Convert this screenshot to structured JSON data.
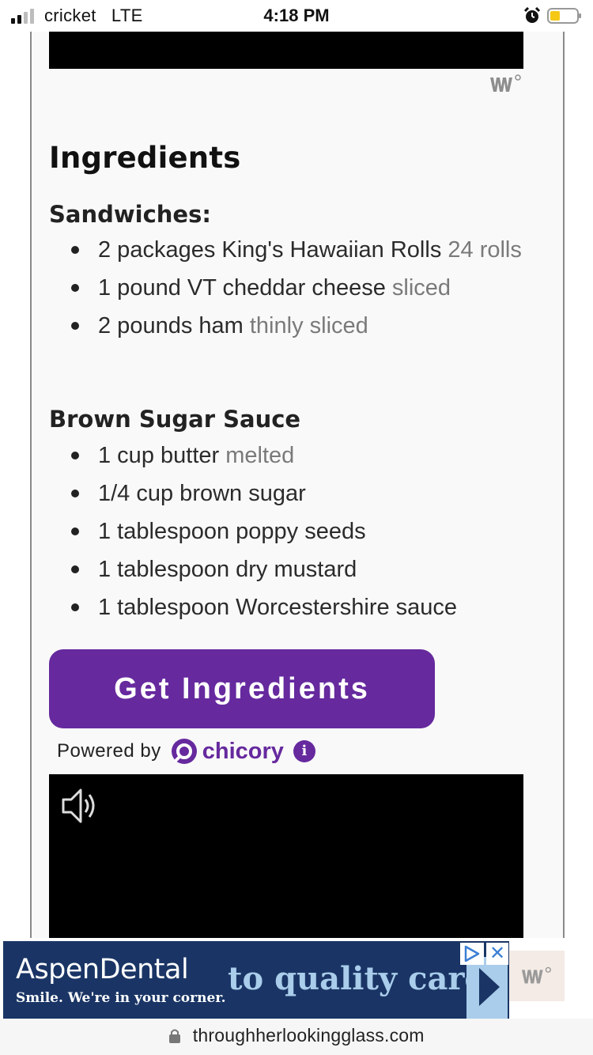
{
  "status_bar": {
    "carrier": "cricket",
    "network": "LTE",
    "time": "4:18 PM"
  },
  "recipe": {
    "section_title": "Ingredients",
    "groups": [
      {
        "title": "Sandwiches:",
        "items": [
          {
            "text": "2 packages King's Hawaiian Rolls",
            "note": "24 rolls"
          },
          {
            "text": "1 pound VT cheddar cheese",
            "note": "sliced"
          },
          {
            "text": "2 pounds ham",
            "note": "thinly sliced"
          }
        ]
      },
      {
        "title": "Brown Sugar Sauce",
        "items": [
          {
            "text": "1 cup butter",
            "note": "melted"
          },
          {
            "text": "1/4 cup brown sugar",
            "note": ""
          },
          {
            "text": "1 tablespoon poppy seeds",
            "note": ""
          },
          {
            "text": "1 tablespoon dry mustard",
            "note": ""
          },
          {
            "text": "1 tablespoon Worcestershire sauce",
            "note": ""
          }
        ]
      }
    ]
  },
  "chicory": {
    "button_label": "Get Ingredients",
    "powered_by": "Powered by",
    "brand": "chicory",
    "info_symbol": "i",
    "brand_color": "#66299e"
  },
  "ad": {
    "brand": "AspenDental",
    "tagline": "Smile. We're in your corner.",
    "message": "to quality care",
    "close_symbol": "✕",
    "background_color": "#1a3565"
  },
  "url_bar": {
    "url": "throughherlookingglass.com"
  },
  "icons": [
    "signal-icon",
    "alarm-icon",
    "battery-icon",
    "wp-logo-icon",
    "chicory-logo-icon",
    "info-icon",
    "speaker-icon",
    "adchoices-icon",
    "close-icon",
    "lock-icon"
  ]
}
